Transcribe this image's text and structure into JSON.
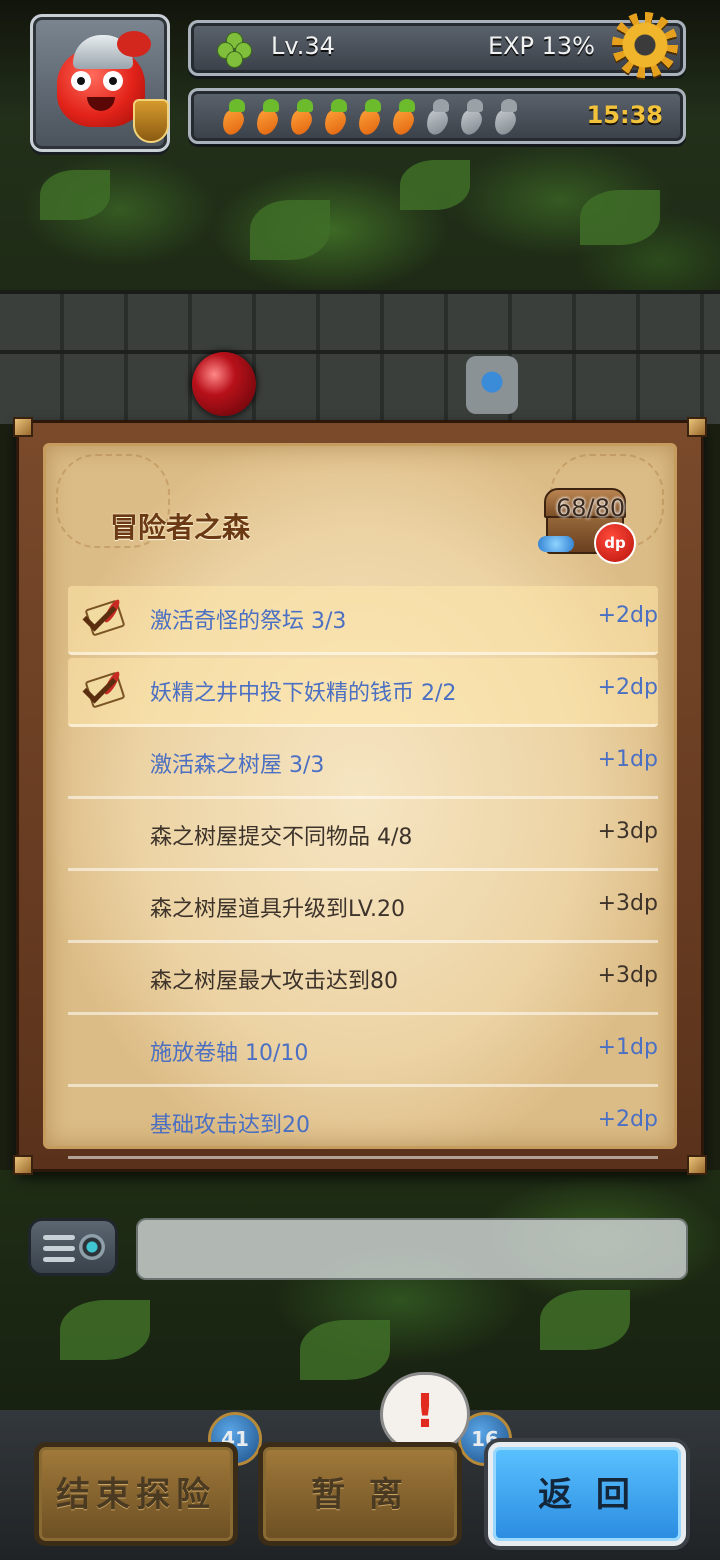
{
  "hud": {
    "level_label": "Lv.34",
    "exp_label": "EXP 13%",
    "timer": "15:38",
    "energy": {
      "filled": 6,
      "total": 9
    },
    "icons": {
      "level": "clover-icon",
      "settings": "gear-icon",
      "energy": "carrot-icon"
    }
  },
  "panel": {
    "title": "冒险者之森",
    "progress": "68/80",
    "badge": "dp",
    "quests": [
      {
        "text": "激活奇怪的祭坛 3/3",
        "reward": "+2dp",
        "status": "done",
        "claimed": true
      },
      {
        "text": "妖精之井中投下妖精的钱币 2/2",
        "reward": "+2dp",
        "status": "done",
        "claimed": true
      },
      {
        "text": "激活森之树屋 3/3",
        "reward": "+1dp",
        "status": "done",
        "claimed": false
      },
      {
        "text": "森之树屋提交不同物品 4/8",
        "reward": "+3dp",
        "status": "open",
        "claimed": false
      },
      {
        "text": "森之树屋道具升级到LV.20",
        "reward": "+3dp",
        "status": "open",
        "claimed": false
      },
      {
        "text": "森之树屋最大攻击达到80",
        "reward": "+3dp",
        "status": "open",
        "claimed": false
      },
      {
        "text": "施放卷轴 10/10",
        "reward": "+1dp",
        "status": "done",
        "claimed": false
      },
      {
        "text": "基础攻击达到20",
        "reward": "+2dp",
        "status": "done",
        "claimed": false
      }
    ],
    "colors": {
      "done": "#4b6fc2",
      "open": "#3d332a",
      "title": "#6b3a14"
    }
  },
  "bottom": {
    "end_button": "结束探险",
    "pause_button": "暂 离",
    "back_button": "返 回",
    "alert": "!",
    "left_badge": "41",
    "right_badge": "16"
  }
}
